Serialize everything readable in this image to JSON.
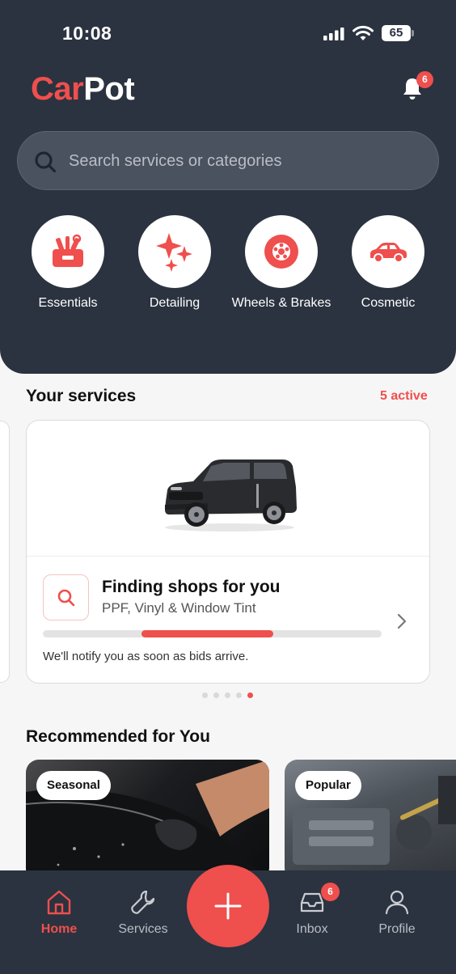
{
  "status_bar": {
    "time": "10:08",
    "battery": "65"
  },
  "header": {
    "logo_part1": "Car",
    "logo_part2": "Pot",
    "notification_count": "6"
  },
  "search": {
    "placeholder": "Search services or categories"
  },
  "categories": [
    {
      "label": "Essentials",
      "icon": "toolbox-icon"
    },
    {
      "label": "Detailing",
      "icon": "sparkles-icon"
    },
    {
      "label": "Wheels & Brakes",
      "icon": "tire-icon"
    },
    {
      "label": "Cosmetic",
      "icon": "car-icon"
    }
  ],
  "your_services": {
    "title": "Your services",
    "active_label": "5 active",
    "card": {
      "title": "Finding shops for you",
      "subtitle": "PPF, Vinyl & Window Tint",
      "note": "We'll notify you as soon as bids arrive.",
      "progress_start": 0.29,
      "progress_end": 0.68
    },
    "pager": {
      "count": 5,
      "active_index": 4
    }
  },
  "recommended": {
    "title": "Recommended for You",
    "cards": [
      {
        "tag": "Seasonal"
      },
      {
        "tag": "Popular"
      }
    ]
  },
  "tab_bar": {
    "items": [
      {
        "label": "Home"
      },
      {
        "label": "Services"
      },
      {
        "label": "Inbox"
      },
      {
        "label": "Profile"
      }
    ],
    "inbox_badge": "6"
  },
  "colors": {
    "accent": "#ef4f4d",
    "dark": "#2b3340"
  }
}
